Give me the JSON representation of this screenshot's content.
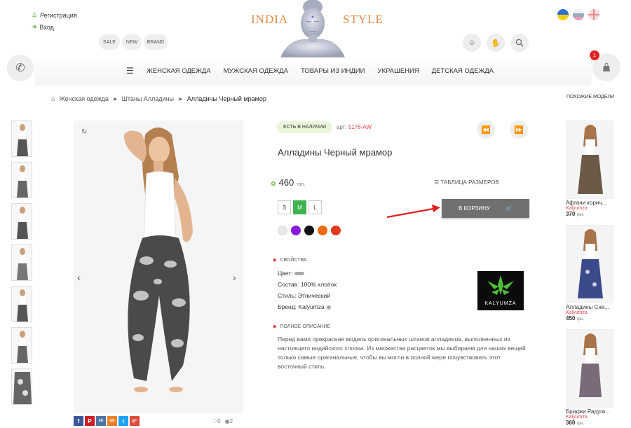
{
  "header": {
    "account": {
      "register": "Регистрация",
      "login": "Вход"
    },
    "filters": [
      "SALE",
      "NEW",
      "BRAND"
    ],
    "logo_left": "INDIA",
    "logo_right": "STYLE",
    "languages": [
      "uk",
      "ru",
      "en"
    ]
  },
  "nav": {
    "items": [
      "ЖЕНСКАЯ ОДЕЖДА",
      "МУЖСКАЯ ОДЕЖДА",
      "ТОВАРЫ ИЗ ИНДИИ",
      "УКРАШЕНИЯ",
      "ДЕТСКАЯ ОДЕЖДА"
    ]
  },
  "cart": {
    "count": "1"
  },
  "breadcrumbs": [
    "Женская одежда",
    "Штаны Алладины",
    "Алладины Черный мрамор"
  ],
  "similar_title": "ПОХОЖИЕ МОДЕЛИ",
  "product": {
    "stock": "ЕСТЬ В НАЛИЧИИ",
    "sku_label": "арт:",
    "sku": "5176-AW",
    "title": "Алладины Черный мрамор",
    "price": "460",
    "currency": "грн.",
    "size_table": "ТАБЛИЦА РАЗМЕРОВ",
    "sizes": [
      "S",
      "M",
      "L"
    ],
    "selected_size": "M",
    "add_to_cart": "В КОРЗИНУ",
    "colors": [
      "#e8e8e8",
      "#8a1ee0",
      "#111111",
      "#ee6a14",
      "#e03a1a"
    ],
    "props_title": "СВОЙСТВА",
    "props": {
      "color_label": "Цвет:",
      "composition": "Состав: 100% хлопок",
      "style": "Стиль: Этнический",
      "brand_label": "Бренд:",
      "brand": "Kalyumza"
    },
    "brand_logo_text": "KALYUMZA",
    "desc_title": "ПОЛНОЕ ОПИСАНИЕ",
    "description": "Перед вами прекрасная модель оригинальных штанов алладинов, выполненных из настоящего индийского хлопка. Из множества расцветок мы выбираем для наших вещей только самые оригинальные, чтобы вы могли в полной мере почувствовать этот восточный стиль."
  },
  "social": {
    "buttons": [
      "f",
      "P",
      "vk",
      "ok",
      "t",
      "g+"
    ],
    "likes": "0",
    "views": "2"
  },
  "similar": [
    {
      "name": "Афгани корич...",
      "brand": "Kalyumza",
      "price": "370",
      "currency": "грн."
    },
    {
      "name": "Алладины Сне...",
      "brand": "Kalyumza",
      "price": "450",
      "currency": "грн."
    },
    {
      "name": "Бриджи Радуга...",
      "brand": "Kalyumza",
      "price": "360",
      "currency": "грн."
    }
  ]
}
